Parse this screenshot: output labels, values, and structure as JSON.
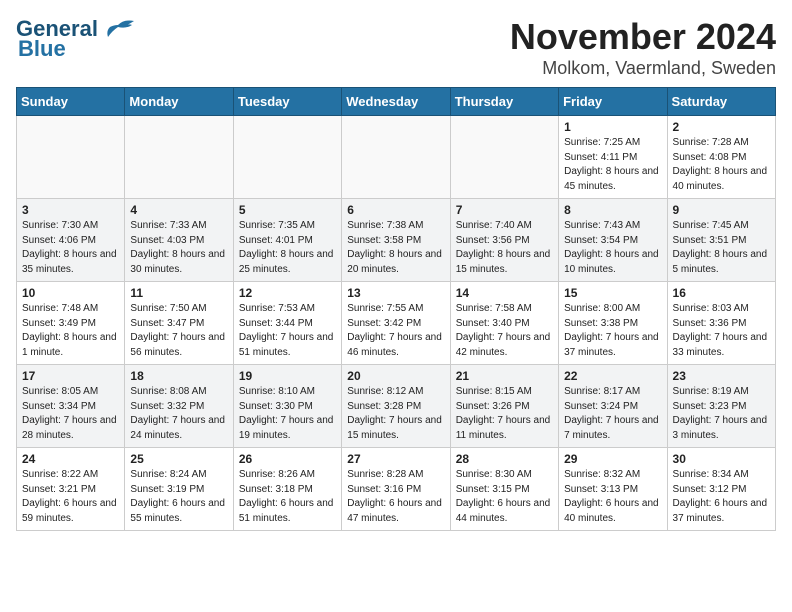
{
  "logo": {
    "general": "General",
    "blue": "Blue"
  },
  "title": "November 2024",
  "subtitle": "Molkom, Vaermland, Sweden",
  "days_header": [
    "Sunday",
    "Monday",
    "Tuesday",
    "Wednesday",
    "Thursday",
    "Friday",
    "Saturday"
  ],
  "weeks": [
    [
      {
        "day": "",
        "info": ""
      },
      {
        "day": "",
        "info": ""
      },
      {
        "day": "",
        "info": ""
      },
      {
        "day": "",
        "info": ""
      },
      {
        "day": "",
        "info": ""
      },
      {
        "day": "1",
        "info": "Sunrise: 7:25 AM\nSunset: 4:11 PM\nDaylight: 8 hours and 45 minutes."
      },
      {
        "day": "2",
        "info": "Sunrise: 7:28 AM\nSunset: 4:08 PM\nDaylight: 8 hours and 40 minutes."
      }
    ],
    [
      {
        "day": "3",
        "info": "Sunrise: 7:30 AM\nSunset: 4:06 PM\nDaylight: 8 hours and 35 minutes."
      },
      {
        "day": "4",
        "info": "Sunrise: 7:33 AM\nSunset: 4:03 PM\nDaylight: 8 hours and 30 minutes."
      },
      {
        "day": "5",
        "info": "Sunrise: 7:35 AM\nSunset: 4:01 PM\nDaylight: 8 hours and 25 minutes."
      },
      {
        "day": "6",
        "info": "Sunrise: 7:38 AM\nSunset: 3:58 PM\nDaylight: 8 hours and 20 minutes."
      },
      {
        "day": "7",
        "info": "Sunrise: 7:40 AM\nSunset: 3:56 PM\nDaylight: 8 hours and 15 minutes."
      },
      {
        "day": "8",
        "info": "Sunrise: 7:43 AM\nSunset: 3:54 PM\nDaylight: 8 hours and 10 minutes."
      },
      {
        "day": "9",
        "info": "Sunrise: 7:45 AM\nSunset: 3:51 PM\nDaylight: 8 hours and 5 minutes."
      }
    ],
    [
      {
        "day": "10",
        "info": "Sunrise: 7:48 AM\nSunset: 3:49 PM\nDaylight: 8 hours and 1 minute."
      },
      {
        "day": "11",
        "info": "Sunrise: 7:50 AM\nSunset: 3:47 PM\nDaylight: 7 hours and 56 minutes."
      },
      {
        "day": "12",
        "info": "Sunrise: 7:53 AM\nSunset: 3:44 PM\nDaylight: 7 hours and 51 minutes."
      },
      {
        "day": "13",
        "info": "Sunrise: 7:55 AM\nSunset: 3:42 PM\nDaylight: 7 hours and 46 minutes."
      },
      {
        "day": "14",
        "info": "Sunrise: 7:58 AM\nSunset: 3:40 PM\nDaylight: 7 hours and 42 minutes."
      },
      {
        "day": "15",
        "info": "Sunrise: 8:00 AM\nSunset: 3:38 PM\nDaylight: 7 hours and 37 minutes."
      },
      {
        "day": "16",
        "info": "Sunrise: 8:03 AM\nSunset: 3:36 PM\nDaylight: 7 hours and 33 minutes."
      }
    ],
    [
      {
        "day": "17",
        "info": "Sunrise: 8:05 AM\nSunset: 3:34 PM\nDaylight: 7 hours and 28 minutes."
      },
      {
        "day": "18",
        "info": "Sunrise: 8:08 AM\nSunset: 3:32 PM\nDaylight: 7 hours and 24 minutes."
      },
      {
        "day": "19",
        "info": "Sunrise: 8:10 AM\nSunset: 3:30 PM\nDaylight: 7 hours and 19 minutes."
      },
      {
        "day": "20",
        "info": "Sunrise: 8:12 AM\nSunset: 3:28 PM\nDaylight: 7 hours and 15 minutes."
      },
      {
        "day": "21",
        "info": "Sunrise: 8:15 AM\nSunset: 3:26 PM\nDaylight: 7 hours and 11 minutes."
      },
      {
        "day": "22",
        "info": "Sunrise: 8:17 AM\nSunset: 3:24 PM\nDaylight: 7 hours and 7 minutes."
      },
      {
        "day": "23",
        "info": "Sunrise: 8:19 AM\nSunset: 3:23 PM\nDaylight: 7 hours and 3 minutes."
      }
    ],
    [
      {
        "day": "24",
        "info": "Sunrise: 8:22 AM\nSunset: 3:21 PM\nDaylight: 6 hours and 59 minutes."
      },
      {
        "day": "25",
        "info": "Sunrise: 8:24 AM\nSunset: 3:19 PM\nDaylight: 6 hours and 55 minutes."
      },
      {
        "day": "26",
        "info": "Sunrise: 8:26 AM\nSunset: 3:18 PM\nDaylight: 6 hours and 51 minutes."
      },
      {
        "day": "27",
        "info": "Sunrise: 8:28 AM\nSunset: 3:16 PM\nDaylight: 6 hours and 47 minutes."
      },
      {
        "day": "28",
        "info": "Sunrise: 8:30 AM\nSunset: 3:15 PM\nDaylight: 6 hours and 44 minutes."
      },
      {
        "day": "29",
        "info": "Sunrise: 8:32 AM\nSunset: 3:13 PM\nDaylight: 6 hours and 40 minutes."
      },
      {
        "day": "30",
        "info": "Sunrise: 8:34 AM\nSunset: 3:12 PM\nDaylight: 6 hours and 37 minutes."
      }
    ]
  ]
}
